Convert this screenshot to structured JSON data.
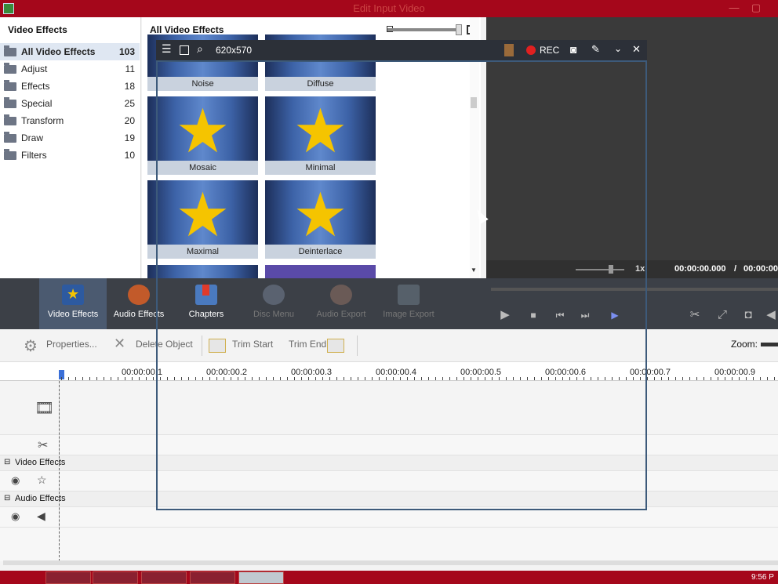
{
  "window": {
    "title": "Edit Input Video"
  },
  "effects_panel": {
    "header": "Video Effects",
    "categories": [
      {
        "label": "All Video Effects",
        "count": "103"
      },
      {
        "label": "Adjust",
        "count": "11"
      },
      {
        "label": "Effects",
        "count": "18"
      },
      {
        "label": "Special",
        "count": "25"
      },
      {
        "label": "Transform",
        "count": "20"
      },
      {
        "label": "Draw",
        "count": "19"
      },
      {
        "label": "Filters",
        "count": "10"
      }
    ]
  },
  "grid": {
    "header": "All Video Effects",
    "effects": [
      "Noise",
      "Diffuse",
      "Mosaic",
      "Minimal",
      "Maximal",
      "Deinterlace"
    ]
  },
  "capture_bar": {
    "size": "620x570",
    "rec": "REC"
  },
  "preview": {
    "speed": "1x",
    "time_current": "00:00:00.000",
    "time_sep": "/",
    "time_total": "00:00:00"
  },
  "toolbar": {
    "tools": [
      {
        "label": "Video Effects"
      },
      {
        "label": "Audio Effects"
      },
      {
        "label": "Chapters"
      },
      {
        "label": "Disc Menu"
      },
      {
        "label": "Audio Export"
      },
      {
        "label": "Image Export"
      }
    ]
  },
  "editbar": {
    "properties": "Properties...",
    "delete": "Delete Object",
    "trim_start": "Trim Start",
    "trim_end": "Trim End",
    "zoom": "Zoom:"
  },
  "ruler": {
    "ticks": [
      "00:00:00.1",
      "00:00:00.2",
      "00:00:00.3",
      "00:00:00.4",
      "00:00:00.5",
      "00:00:00.6",
      "00:00:00.7",
      "00:00:00.9"
    ]
  },
  "tracks": {
    "video_effects": "Video Effects",
    "audio_effects": "Audio Effects"
  },
  "taskbar": {
    "clock": "9:56 P"
  },
  "colors": {
    "titlebar": "#a5071b",
    "toolbar": "#3c4047",
    "accent_star": "#f5c400",
    "rec": "#e02020"
  }
}
